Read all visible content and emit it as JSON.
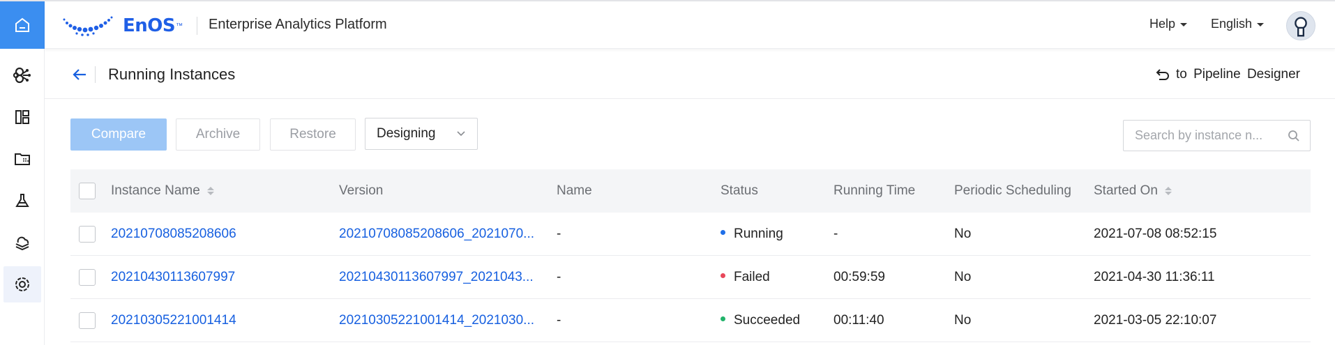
{
  "header": {
    "logo_text": "EnOS",
    "logo_tm": "™",
    "app_title": "Enterprise Analytics Platform",
    "help_label": "Help",
    "language_label": "English"
  },
  "rail": {
    "items": [
      "home-icon",
      "model-icon",
      "dashboard-icon",
      "folder-grid-icon",
      "flask-icon",
      "cloud-layers-icon",
      "gear-ring-icon"
    ],
    "accent_color": "#3b8ef0"
  },
  "page": {
    "title": "Running Instances",
    "to_designer": "to Pipeline Designer"
  },
  "toolbar": {
    "compare_label": "Compare",
    "archive_label": "Archive",
    "restore_label": "Restore",
    "select_value": "Designing",
    "search_placeholder": "Search by instance n..."
  },
  "table": {
    "columns": [
      "Instance Name",
      "Version",
      "Name",
      "Status",
      "Running Time",
      "Periodic Scheduling",
      "Started On"
    ],
    "rows": [
      {
        "instance": "20210708085208606",
        "version": "20210708085208606_2021070...",
        "name": "-",
        "status": "Running",
        "status_color": "#1f6fe8",
        "running_time": "-",
        "periodic": "No",
        "started": "2021-07-08 08:52:15"
      },
      {
        "instance": "20210430113607997",
        "version": "20210430113607997_2021043...",
        "name": "-",
        "status": "Failed",
        "status_color": "#e8475a",
        "running_time": "00:59:59",
        "periodic": "No",
        "started": "2021-04-30 11:36:11"
      },
      {
        "instance": "20210305221001414",
        "version": "20210305221001414_2021030...",
        "name": "-",
        "status": "Succeeded",
        "status_color": "#21b36a",
        "running_time": "00:11:40",
        "periodic": "No",
        "started": "2021-03-05 22:10:07"
      }
    ]
  }
}
